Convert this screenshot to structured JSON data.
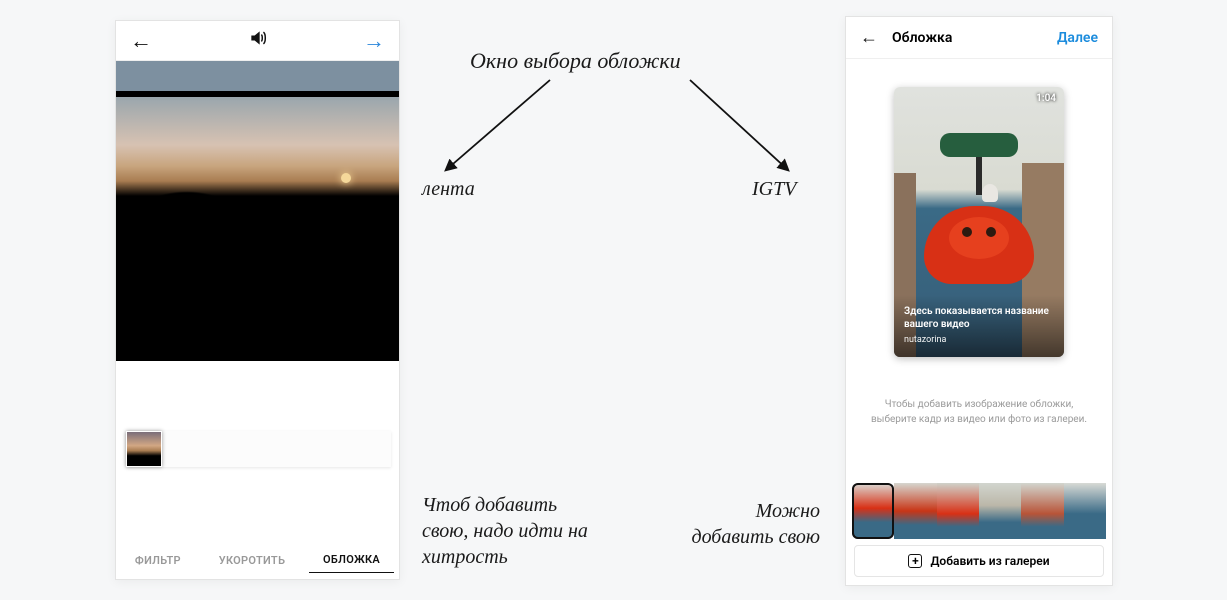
{
  "annotations": {
    "top_center": "Окно выбора обложки",
    "left_label": "лента",
    "right_label": "IGTV",
    "bottom_left": "Чтоб добавить свою, надо идти на хитрость",
    "bottom_right": "Можно добавить свою"
  },
  "left_phone": {
    "tabs": {
      "filter": "ФИЛЬТР",
      "trim": "УКОРОТИТЬ",
      "cover": "ОБЛОЖКА"
    }
  },
  "right_phone": {
    "header": {
      "title": "Обложка",
      "next": "Далее"
    },
    "cover": {
      "time": "1:04",
      "title_line": "Здесь показывается название вашего видео",
      "username": "nutazorina"
    },
    "hint": "Чтобы добавить изображение обложки, выберите кадр из видео или фото из галереи.",
    "add_button": "Добавить из галереи"
  }
}
